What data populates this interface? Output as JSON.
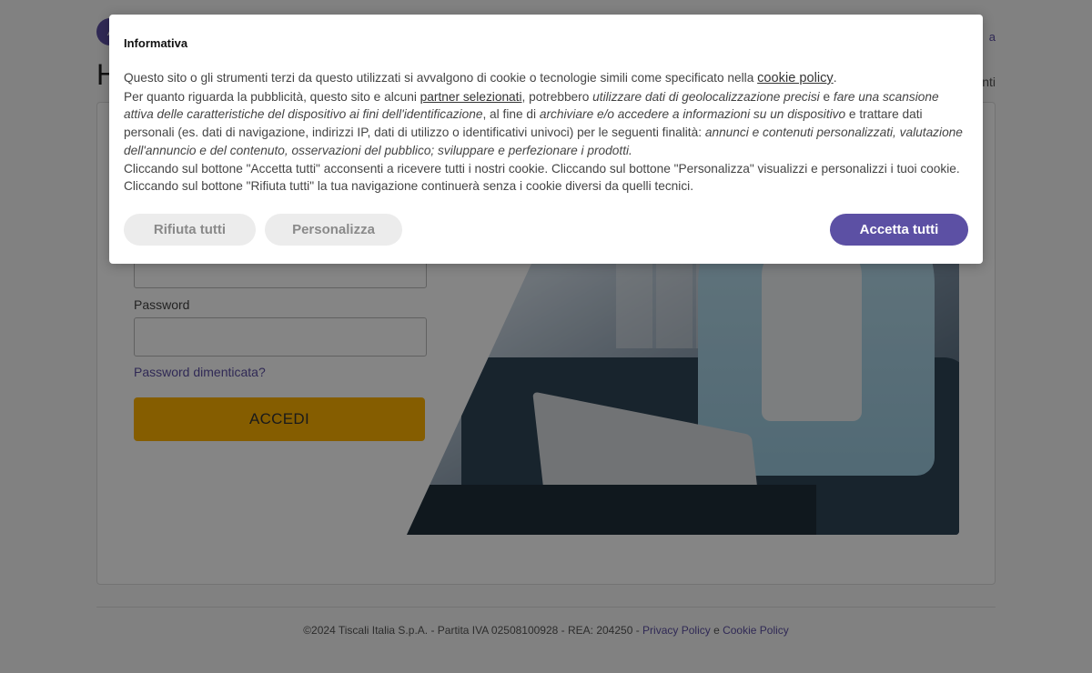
{
  "header": {
    "logo_glyph": "/",
    "top_link": "a",
    "page_heading": "H",
    "sub_link": "nti"
  },
  "login": {
    "password_label": "Password",
    "forgot_password": "Password dimenticata?",
    "submit_label": "ACCEDI"
  },
  "footer": {
    "prefix": "©2024 Tiscali Italia S.p.A. - Partita IVA 02508100928 - REA: 204250 - ",
    "privacy_link": "Privacy Policy",
    "conjunction": " e ",
    "cookie_link": "Cookie Policy"
  },
  "cookie_dialog": {
    "title": "Informativa",
    "p1_text": "Questo sito o gli strumenti terzi da questo utilizzati si avvalgono di cookie o tecnologie simili come specificato nella ",
    "p1_link": "cookie policy",
    "p1_end": ".",
    "p2_a": "Per quanto riguarda la pubblicità, questo sito e alcuni ",
    "p2_link": "partner selezionati",
    "p2_b": ", potrebbero ",
    "p2_em1": "utilizzare dati di geolocalizzazione precisi",
    "p2_c": " e ",
    "p2_em2": "fare una scansione attiva delle caratteristiche del dispositivo ai fini dell'identificazione",
    "p2_d": ", al fine di ",
    "p2_em3": "archiviare e/o accedere a informazioni su un dispositivo",
    "p2_e": " e trattare dati personali (es. dati di navigazione, indirizzi IP, dati di utilizzo o identificativi univoci) per le seguenti finalità: ",
    "p2_em4": "annunci e contenuti personalizzati, valutazione dell'annuncio e del contenuto, osservazioni del pubblico; sviluppare e perfezionare i prodotti.",
    "p3": "Cliccando sul bottone \"Accetta tutti\" acconsenti a ricevere tutti i nostri cookie. Cliccando sul bottone \"Personalizza\" visualizzi e personalizzi i tuoi cookie. Cliccando sul bottone \"Rifiuta tutti\" la tua navigazione continuerà senza i cookie diversi da quelli tecnici.",
    "reject_label": "Rifiuta tutti",
    "customize_label": "Personalizza",
    "accept_label": "Accetta tutti"
  },
  "colors": {
    "brand": "#5c50a4",
    "login_button": "#ffb300",
    "secondary_button": "#ececec"
  }
}
